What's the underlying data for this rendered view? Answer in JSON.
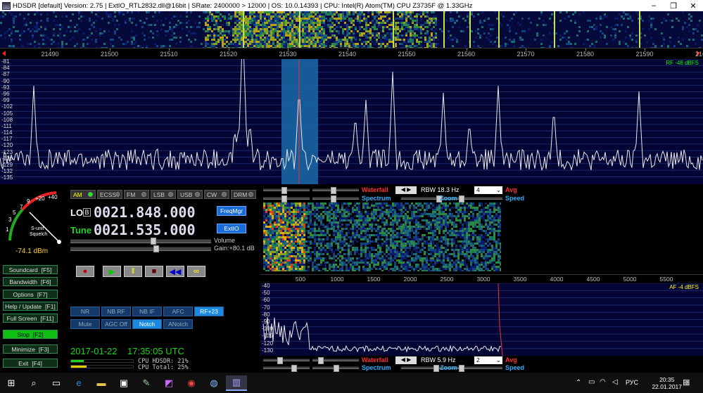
{
  "titlebar": {
    "title": "HDSDR  [default]  Version: 2.75   |  ExtIO_RTL2832.dll@16bit   |  SRate: 2400000 > 12000   |  OS: 10.0.14393   |  CPU: Intel(R) Atom(TM) CPU  Z3735F @ 1.33GHz",
    "minimize": "–",
    "restore": "❐",
    "close": "✕"
  },
  "freq_axis": {
    "labels": [
      "21490",
      "21500",
      "21510",
      "21520",
      "21530",
      "21540",
      "21550",
      "21560",
      "21570",
      "21580",
      "21590",
      "21600"
    ]
  },
  "spectrum": {
    "db_labels": [
      "-81",
      "-84",
      "-87",
      "-90",
      "-93",
      "-96",
      "-99",
      "-102",
      "-105",
      "-108",
      "-111",
      "-114",
      "-117",
      "-120",
      "-123",
      "-126",
      "-129",
      "-132",
      "-135"
    ],
    "rf_level": "RF  -48 dBFS"
  },
  "smeter": {
    "scale": [
      "1",
      "3",
      "5",
      "7",
      "9",
      "+20",
      "+40"
    ],
    "label_line1": "S-unit",
    "label_line2": "Squelch",
    "dbm": "-74.1 dBm"
  },
  "modes": [
    {
      "label": "AM",
      "selected": true
    },
    {
      "label": "ECSS",
      "selected": false
    },
    {
      "label": "FM",
      "selected": false
    },
    {
      "label": "LSB",
      "selected": false
    },
    {
      "label": "USB",
      "selected": false
    },
    {
      "label": "CW",
      "selected": false
    },
    {
      "label": "DRM",
      "selected": false
    }
  ],
  "lo": {
    "label": "LO",
    "badge": "B",
    "value": "0021.848.000"
  },
  "tune": {
    "label": "Tune",
    "value": "0021.535.000"
  },
  "buttons": {
    "freqmgr": "FreqMgr",
    "extio": "ExtIO"
  },
  "volume": {
    "label": "Volume",
    "gain": "Gain:+80.1 dB"
  },
  "side_buttons": [
    {
      "label": "Soundcard",
      "key": "[F5]"
    },
    {
      "label": "Bandwidth",
      "key": "[F6]"
    },
    {
      "label": "Options",
      "key": "[F7]"
    },
    {
      "label": "Help / Update",
      "key": "[F1]"
    },
    {
      "label": "Full Screen",
      "key": "[F11]"
    },
    {
      "label": "Stop",
      "key": "[F2]"
    },
    {
      "label": "Minimize",
      "key": "[F3]"
    },
    {
      "label": "Exit",
      "key": "[F4]"
    }
  ],
  "transport": {
    "record": "●",
    "play": "▶",
    "pause": "‖",
    "stop": "■",
    "rewind": "◀◀",
    "loop": "∞"
  },
  "dsp_row1": [
    "NR",
    "NB RF",
    "NB IF",
    "AFC",
    "RF+23"
  ],
  "dsp_row2": [
    "Mute",
    "AGC Off",
    "Notch",
    "ANotch"
  ],
  "datetime": {
    "date": "2017-01-22",
    "time": "17:35:05 UTC"
  },
  "cpu": {
    "hdsdr": "CPU HDSDR: 21%",
    "total": "CPU Total: 25%",
    "hdsdr_fraction": 0.21,
    "total_fraction": 0.25
  },
  "waterfall_ctrl_top": {
    "waterfall": "Waterfall",
    "spectrum": "Spectrum",
    "rbw": "RBW 18.3 Hz",
    "zoom": "Zoom",
    "avg_value": "4",
    "avg": "Avg",
    "speed": "Speed"
  },
  "waterfall_ctrl_bottom": {
    "waterfall": "Waterfall",
    "spectrum": "Spectrum",
    "rbw": "RBW  5.9 Hz",
    "zoom": "Zoom",
    "avg_value": "2",
    "avg": "Avg",
    "speed": "Speed"
  },
  "af_axis": {
    "labels": [
      "500",
      "1000",
      "1500",
      "2000",
      "2500",
      "3000",
      "3500",
      "4000",
      "4500",
      "5000",
      "5500"
    ]
  },
  "af_spectrum": {
    "db_labels": [
      "-40",
      "-50",
      "-60",
      "-70",
      "-80",
      "-90",
      "-100",
      "-110",
      "-120",
      "-130"
    ],
    "af_level": "AF  -4 dBFS"
  },
  "taskbar": {
    "lang": "РУС",
    "time": "20:35",
    "date": "22.01.2017",
    "notif": "2"
  },
  "colors": {
    "lcd_bg": "#000",
    "lo_label": "#ffffff",
    "tune_label": "#1fd51f",
    "waterfall_label": "#ff3030",
    "spectrum_label": "#30b0ff"
  }
}
